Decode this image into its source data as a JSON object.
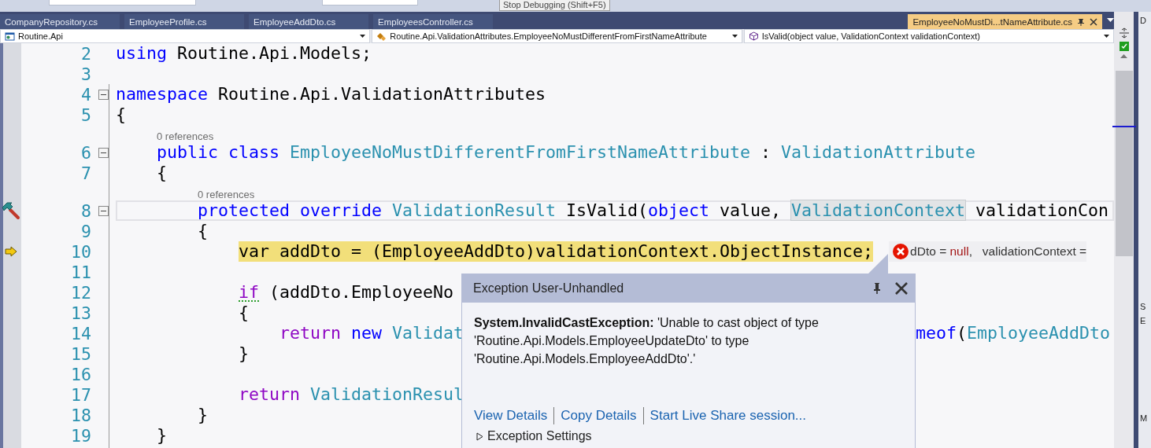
{
  "toolbar": {
    "tooltip": "Stop Debugging (Shift+F5)"
  },
  "tabs": [
    {
      "label": "CompanyRepository.cs",
      "selected": false,
      "pinned": false
    },
    {
      "label": "EmployeeProfile.cs",
      "selected": false,
      "pinned": false
    },
    {
      "label": "EmployeeAddDto.cs",
      "selected": false,
      "pinned": false
    },
    {
      "label": "EmployeesController.cs",
      "selected": false,
      "pinned": false
    },
    {
      "label": "EmployeeNoMustDi...tNameAttribute.cs",
      "selected": true,
      "pinned": true
    }
  ],
  "navigation_bar": [
    {
      "kind": "project",
      "label": "Routine.Api"
    },
    {
      "kind": "class",
      "label": "Routine.Api.ValidationAttributes.EmployeeNoMustDifferentFromFirstNameAttribute"
    },
    {
      "kind": "method",
      "label": "IsValid(object value, ValidationContext validationContext)"
    }
  ],
  "editor": {
    "lines": [
      {
        "kind": "code",
        "number": "2",
        "foldable": false,
        "current": false,
        "executing": false,
        "tokens": [
          {
            "text": "using",
            "kind": "keyword"
          },
          {
            "text": " Routine.Api.Models;",
            "kind": "plain"
          }
        ]
      },
      {
        "kind": "code",
        "number": "3",
        "foldable": false,
        "current": false,
        "executing": false
      },
      {
        "kind": "code",
        "number": "4",
        "foldable": true,
        "current": false,
        "executing": false,
        "tokens": [
          {
            "text": "namespace",
            "kind": "keyword"
          },
          {
            "text": " Routine.Api.ValidationAttributes",
            "kind": "plain"
          }
        ]
      },
      {
        "kind": "code",
        "number": "5",
        "foldable": false,
        "current": false,
        "executing": false,
        "tokens": [
          {
            "text": "{",
            "kind": "plain"
          }
        ]
      },
      {
        "kind": "lens",
        "text": "    0 references"
      },
      {
        "kind": "code",
        "number": "6",
        "foldable": true,
        "current": false,
        "executing": false,
        "tokens": [
          {
            "text": "    public class",
            "kind": "keyword"
          },
          {
            "text": " EmployeeNoMustDifferentFromFirstNameAttribute",
            "kind": "type"
          },
          {
            "text": " : ",
            "kind": "plain"
          },
          {
            "text": "ValidationAttribute",
            "kind": "type"
          }
        ]
      },
      {
        "kind": "code",
        "number": "7",
        "foldable": false,
        "current": false,
        "executing": false,
        "tokens": [
          {
            "text": "    {",
            "kind": "plain"
          }
        ]
      },
      {
        "kind": "lens",
        "text": "        0 references"
      },
      {
        "kind": "code",
        "number": "8",
        "foldable": true,
        "current": true,
        "executing": false,
        "marker": {
          "kind": "hammer"
        },
        "tokens": [
          {
            "text": "        protected override",
            "kind": "keyword"
          },
          {
            "text": " ValidationResult",
            "kind": "type"
          },
          {
            "text": " IsValid(",
            "kind": "plain"
          },
          {
            "text": "object",
            "kind": "keyword"
          },
          {
            "text": " value, ",
            "kind": "plain"
          },
          {
            "text": "ValidationContext",
            "kind": "reference"
          },
          {
            "text": " validationCon",
            "kind": "plain"
          }
        ]
      },
      {
        "kind": "code",
        "number": "9",
        "foldable": false,
        "current": false,
        "executing": false,
        "tokens": [
          {
            "text": "        {",
            "kind": "plain"
          }
        ]
      },
      {
        "kind": "code",
        "number": "10",
        "foldable": false,
        "current": false,
        "executing": true,
        "marker": {
          "kind": "arrow"
        },
        "tokens": [
          {
            "text": "            var",
            "kind": "keyword"
          },
          {
            "text": " addDto = (EmployeeAddDto)validationContext.ObjectInstance;",
            "kind": "plain"
          }
        ],
        "datatip": {
          "error": true,
          "tokens": [
            {
              "text": "dDto = ",
              "kind": "plain"
            },
            {
              "text": "null",
              "kind": "value"
            },
            {
              "text": ",   validationContext =",
              "kind": "plain"
            }
          ]
        }
      },
      {
        "kind": "code",
        "number": "11",
        "foldable": false,
        "current": false,
        "executing": false
      },
      {
        "kind": "code",
        "number": "12",
        "foldable": false,
        "current": false,
        "executing": false,
        "tokens": [
          {
            "text": "            if",
            "kind": "control",
            "squiggle": true
          },
          {
            "text": " (addDto.EmployeeNo",
            "kind": "plain",
            "squiggle": false
          }
        ]
      },
      {
        "kind": "code",
        "number": "13",
        "foldable": false,
        "current": false,
        "executing": false,
        "tokens": [
          {
            "text": "            {",
            "kind": "plain"
          }
        ]
      },
      {
        "kind": "code",
        "number": "14",
        "foldable": false,
        "current": false,
        "executing": false,
        "tokens": [
          {
            "text": "                return",
            "kind": "control"
          },
          {
            "text": " new",
            "kind": "keyword"
          },
          {
            "text": " Validat",
            "kind": "type"
          }
        ],
        "tokens_right": [
          {
            "text": "meof",
            "kind": "keyword"
          },
          {
            "text": "(",
            "kind": "plain"
          },
          {
            "text": "EmployeeAddDto",
            "kind": "type"
          }
        ]
      },
      {
        "kind": "code",
        "number": "15",
        "foldable": false,
        "current": false,
        "executing": false,
        "tokens": [
          {
            "text": "            }",
            "kind": "plain"
          }
        ]
      },
      {
        "kind": "code",
        "number": "16",
        "foldable": false,
        "current": false,
        "executing": false
      },
      {
        "kind": "code",
        "number": "17",
        "foldable": false,
        "current": false,
        "executing": false,
        "tokens": [
          {
            "text": "            return",
            "kind": "control"
          },
          {
            "text": " ValidationResul",
            "kind": "type"
          }
        ]
      },
      {
        "kind": "code",
        "number": "18",
        "foldable": false,
        "current": false,
        "executing": false,
        "tokens": [
          {
            "text": "        }",
            "kind": "plain"
          }
        ]
      },
      {
        "kind": "code",
        "number": "19",
        "foldable": false,
        "current": false,
        "executing": false,
        "tokens": [
          {
            "text": "    }",
            "kind": "plain"
          }
        ]
      }
    ]
  },
  "exception_popup": {
    "title": "Exception User-Unhandled",
    "pinned": false,
    "message": "**System.InvalidCastException:** 'Unable to cast object of type\n'Routine.Api.Models.EmployeeUpdateDto' to type\n'Routine.Api.Models.EmployeeAddDto'.'",
    "links": [
      "View Details",
      "Copy Details",
      "Start Live Share session..."
    ],
    "settings": {
      "label": "Exception Settings",
      "expanded": false
    }
  },
  "side_panel": {
    "labels": [
      "D",
      "S",
      "E",
      "M"
    ]
  }
}
